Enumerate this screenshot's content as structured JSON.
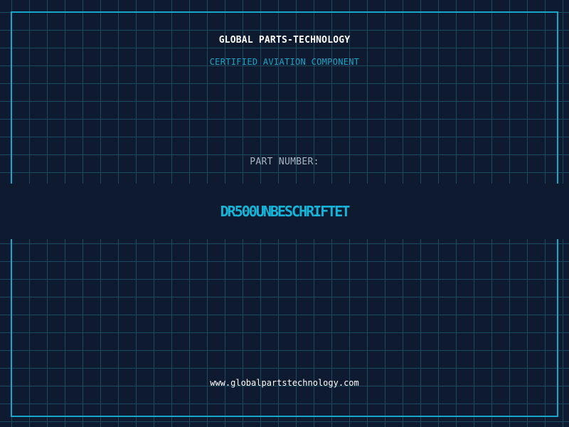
{
  "brand": {
    "name": "GLOBAL PARTS-TECHNOLOGY",
    "tagline": "CERTIFIED AVIATION COMPONENT"
  },
  "part": {
    "label": "PART NUMBER:",
    "number": "DR500UNBESCHRIFTET"
  },
  "footer": {
    "website": "www.globalpartstechnology.com"
  },
  "colors": {
    "background": "#0e1a2f",
    "grid": "#1a4a5e",
    "accent": "#17a6c9",
    "part_number": "#17b4d9",
    "label": "#a9b4c4",
    "text": "#ffffff"
  }
}
